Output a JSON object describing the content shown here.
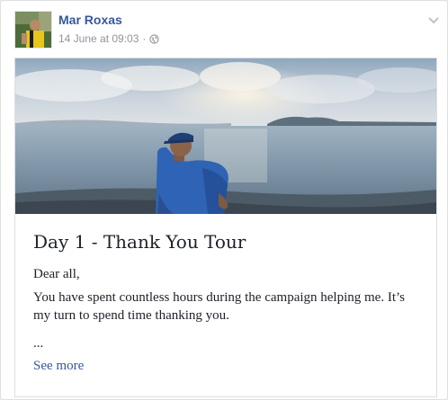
{
  "post": {
    "author": "Mar Roxas",
    "timestamp": "14 June at 09:03",
    "separator": "·",
    "audience_icon": "globe-icon",
    "menu_icon": "chevron-down-icon"
  },
  "note": {
    "title": "Day 1 - Thank You Tour",
    "paragraphs": [
      "Dear all,",
      "You have spent countless hours during the campaign helping me. It’s my turn to spend time thanking you.",
      "..."
    ],
    "see_more": "See more"
  },
  "colors": {
    "link": "#365899",
    "meta": "#90949c",
    "text": "#1d2129",
    "border": "#dddfe2"
  }
}
